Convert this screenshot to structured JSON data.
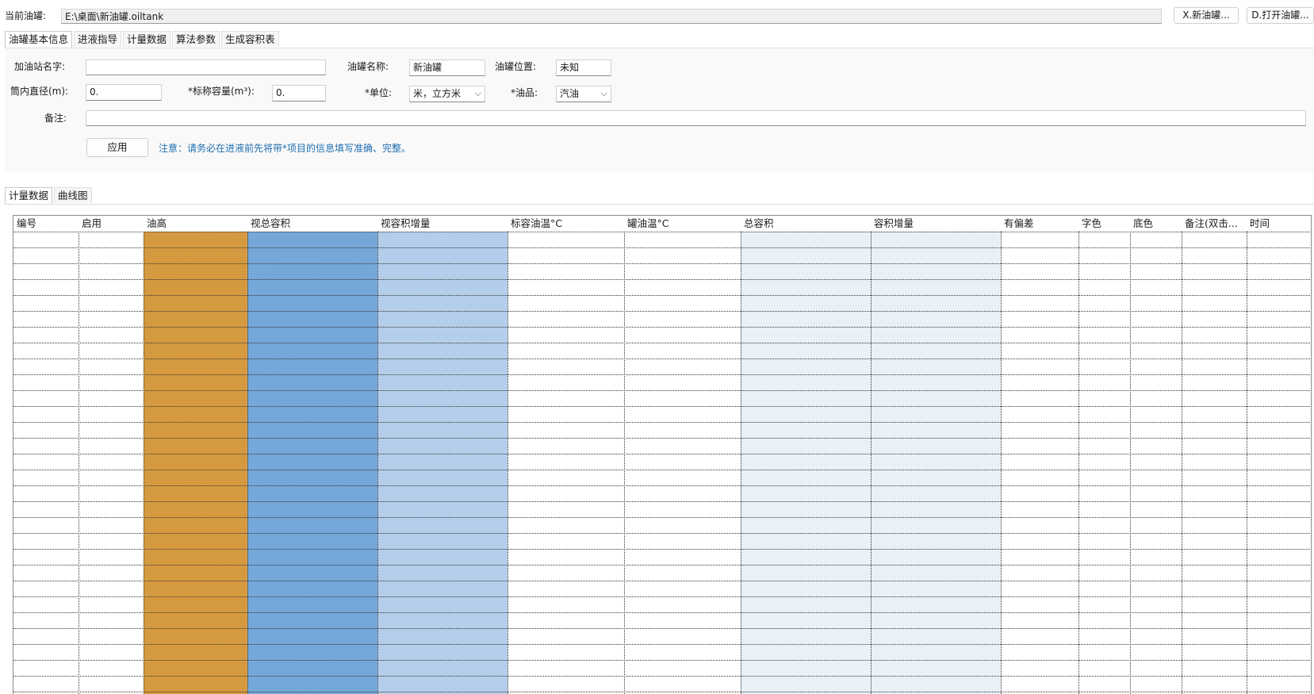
{
  "header": {
    "current_tank_label": "当前油罐:",
    "current_tank_path": "E:\\桌面\\新油罐.oiltank",
    "new_tank_button": "X.新油罐...",
    "open_tank_button": "D.打开油罐..."
  },
  "main_tabs": [
    {
      "label": "油罐基本信息",
      "active": true
    },
    {
      "label": "进液指导",
      "active": false
    },
    {
      "label": "计量数据",
      "active": false
    },
    {
      "label": "算法参数",
      "active": false
    },
    {
      "label": "生成容积表",
      "active": false
    }
  ],
  "form": {
    "station_name_label": "加油站名字:",
    "station_name_value": "",
    "tank_name_label": "油罐名称:",
    "tank_name_value": "新油罐",
    "tank_location_label": "油罐位置:",
    "tank_location_value": "未知",
    "inner_diameter_label": "筒内直径(m):",
    "inner_diameter_value": "0.",
    "nominal_capacity_label": "*标称容量(m³):",
    "nominal_capacity_value": "0.",
    "unit_label": "*单位:",
    "unit_value": "米，立方米",
    "oil_type_label": "*油品:",
    "oil_type_value": "汽油",
    "remarks_label": "备注:",
    "remarks_value": "",
    "apply_button": "应用",
    "notice": "注意：请务必在进液前先将带*项目的信息填写准确、完整。"
  },
  "data_tabs": [
    {
      "label": "计量数据",
      "active": true
    },
    {
      "label": "曲线图",
      "active": false
    }
  ],
  "grid": {
    "columns": [
      {
        "label": "编号",
        "color": "#ffffff"
      },
      {
        "label": "启用",
        "color": "#ffffff"
      },
      {
        "label": "油高",
        "color": "#d59a3f"
      },
      {
        "label": "视总容积",
        "color": "#75a7d8"
      },
      {
        "label": "视容积增量",
        "color": "#b4cdea"
      },
      {
        "label": "标容油温°C",
        "color": "#ffffff"
      },
      {
        "label": "罐油温°C",
        "color": "#ffffff"
      },
      {
        "label": "总容积",
        "color": "#e8f0f8"
      },
      {
        "label": "容积增量",
        "color": "#e8f0f8"
      },
      {
        "label": "有偏差",
        "color": "#ffffff"
      },
      {
        "label": "字色",
        "color": "#ffffff"
      },
      {
        "label": "底色",
        "color": "#ffffff"
      },
      {
        "label": "备注(双击...",
        "color": "#ffffff"
      },
      {
        "label": "时间",
        "color": "#ffffff"
      }
    ]
  }
}
